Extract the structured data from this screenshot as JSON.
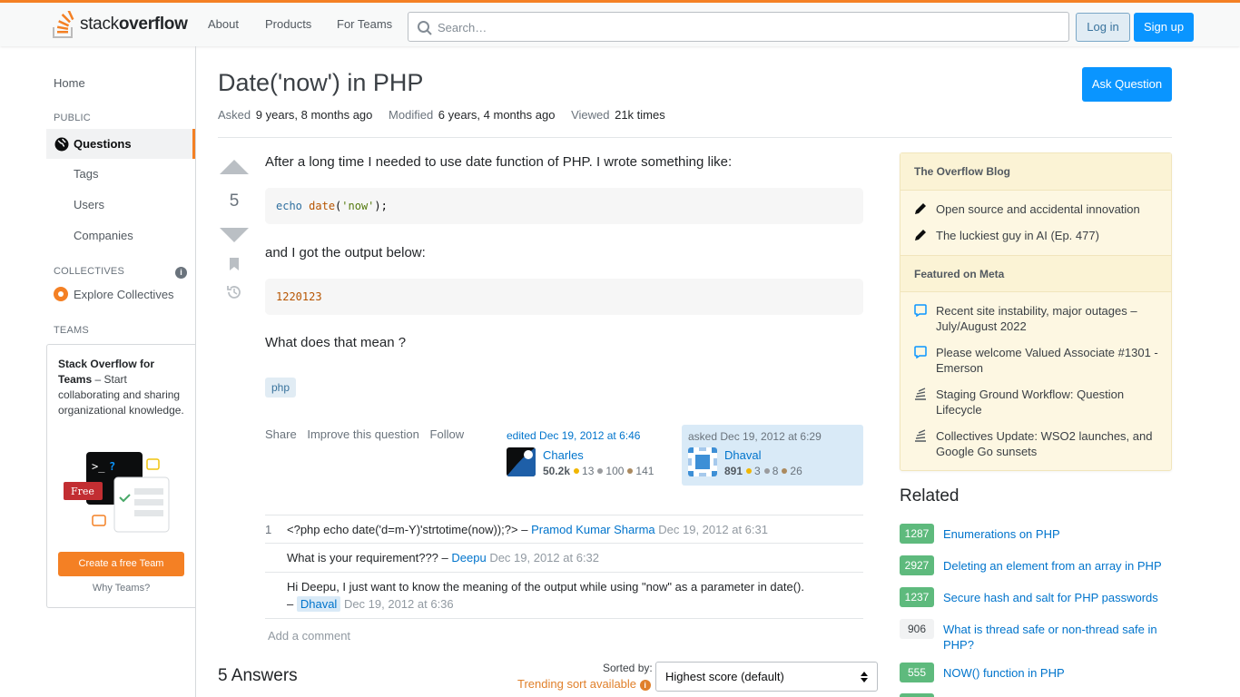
{
  "header": {
    "logo_text_1": "stack",
    "logo_text_2": "overflow",
    "nav": [
      "About",
      "Products",
      "For Teams"
    ],
    "search_placeholder": "Search…",
    "login_label": "Log in",
    "signup_label": "Sign up",
    "accent_color": "#f48024"
  },
  "sidebar": {
    "home": "Home",
    "public_label": "PUBLIC",
    "questions": "Questions",
    "tags": "Tags",
    "users": "Users",
    "companies": "Companies",
    "collectives_label": "COLLECTIVES",
    "explore_collectives": "Explore Collectives",
    "teams_label": "TEAMS",
    "teams_title": "Stack Overflow for Teams",
    "teams_desc": " – Start collaborating and sharing organizational knowledge.",
    "teams_free": "Free",
    "create_team": "Create a free Team",
    "why_teams": "Why Teams?"
  },
  "question": {
    "title": "Date('now') in PHP",
    "asked_label": "Asked",
    "asked_value": "9 years, 8 months ago",
    "modified_label": "Modified",
    "modified_value": "6 years, 4 months ago",
    "viewed_label": "Viewed",
    "viewed_value": "21k times",
    "ask_button": "Ask Question",
    "votes": "5",
    "body_1": "After a long time I needed to use date function of PHP. I wrote something like:",
    "code_1": {
      "kw": "echo",
      "fn": "date",
      "open": "(",
      "str": "'now'",
      "close": ");"
    },
    "body_2": "and I got the output below:",
    "code_2": "1220123",
    "body_3": "What does that mean ?",
    "tags": [
      "php"
    ],
    "actions": [
      "Share",
      "Improve this question",
      "Follow"
    ],
    "edited": "edited Dec 19, 2012 at 6:46",
    "editor": {
      "name": "Charles",
      "rep": "50.2k",
      "gold": "13",
      "silver": "100",
      "bronze": "141"
    },
    "asked_card": "asked Dec 19, 2012 at 6:29",
    "asker": {
      "name": "Dhaval",
      "rep": "891",
      "gold": "3",
      "silver": "8",
      "bronze": "26"
    }
  },
  "comments": [
    {
      "score": "1",
      "text": "<?php echo date('d=m-Y)'strtotime(now));?> – ",
      "user": "Pramod Kumar Sharma",
      "date": "Dec 19, 2012 at 6:31"
    },
    {
      "score": "",
      "text": "What is your requirement??? – ",
      "user": "Deepu",
      "date": "Dec 19, 2012 at 6:32"
    },
    {
      "score": "",
      "text": "Hi Deepu, I just want to know the meaning of the output while using \"now\" as a parameter in date().",
      "dash": "– ",
      "user": "Dhaval",
      "date": "Dec 19, 2012 at 6:36"
    }
  ],
  "add_comment": "Add a comment",
  "answers": {
    "heading": "5 Answers",
    "sorted_by": "Sorted by:",
    "trending": "Trending sort available",
    "sort_value": "Highest score (default)"
  },
  "blog": {
    "heading": "The Overflow Blog",
    "items": [
      "Open source and accidental innovation",
      "The luckiest guy in AI (Ep. 477)"
    ],
    "meta_heading": "Featured on Meta",
    "meta_items": [
      "Recent site instability, major outages – July/August 2022",
      "Please welcome Valued Associate #1301 - Emerson",
      "Staging Ground Workflow: Question Lifecycle",
      "Collectives Update: WSO2 launches, and Google Go sunsets"
    ]
  },
  "related": {
    "heading": "Related",
    "items": [
      {
        "score": "1287",
        "title": "Enumerations on PHP",
        "accepted": true
      },
      {
        "score": "2927",
        "title": "Deleting an element from an array in PHP",
        "accepted": true
      },
      {
        "score": "1237",
        "title": "Secure hash and salt for PHP passwords",
        "accepted": true
      },
      {
        "score": "906",
        "title": "What is thread safe or non-thread safe in PHP?",
        "accepted": false
      },
      {
        "score": "555",
        "title": "NOW() function in PHP",
        "accepted": true
      }
    ]
  }
}
